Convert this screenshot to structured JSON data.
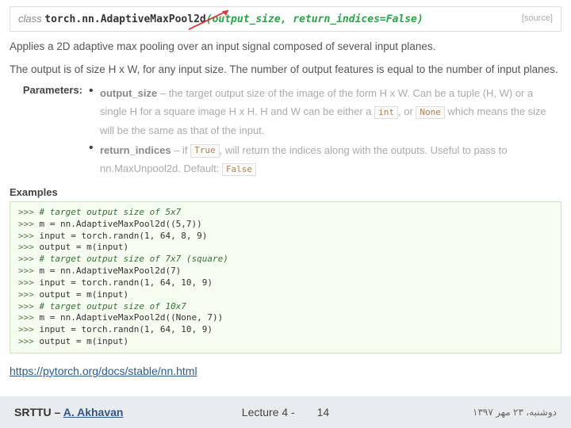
{
  "sig": {
    "kw": "class",
    "name": "torch.nn.AdaptiveMaxPool2d",
    "args": "(output_size, return_indices=False)",
    "source": "[source]"
  },
  "desc1": "Applies a 2D adaptive max pooling over an input signal composed of several input planes.",
  "desc2": "The output is of size H x W, for any input size. The number of output features is equal to the number of input planes.",
  "params_label": "Parameters:",
  "param1": {
    "name": "output_size",
    "t1": " – the target output size of the image of the form H x W. Can be a tuple (H, W) or a single H for a square image H x H. H and W can be either a ",
    "pill1": "int",
    "t2": ", or ",
    "pill2": "None",
    "t3": " which means the size will be the same as that of the input."
  },
  "param2": {
    "name": "return_indices",
    "t1": " – if ",
    "pill1": "True",
    "t2": ", will return the indices along with the outputs. Useful to pass to nn.MaxUnpool2d. Default: ",
    "pill2": "False"
  },
  "examples_label": "Examples",
  "code": {
    "l1": "# target output size of 5x7",
    "l2": "m = nn.AdaptiveMaxPool2d((5,7))",
    "l3": "input = torch.randn(1, 64, 8, 9)",
    "l4": "output = m(input)",
    "l5": "# target output size of 7x7 (square)",
    "l6": "m = nn.AdaptiveMaxPool2d(7)",
    "l7": "input = torch.randn(1, 64, 10, 9)",
    "l8": "output = m(input)",
    "l9": "# target output size of 10x7",
    "l10": "m = nn.AdaptiveMaxPool2d((None, 7))",
    "l11": "input = torch.randn(1, 64, 10, 9)",
    "l12": "output = m(input)",
    "prompt": ">>> "
  },
  "url": "https://pytorch.org/docs/stable/nn.html",
  "footer": {
    "org": "SRTTU – ",
    "author": "A. Akhavan",
    "lecture": "Lecture 4 -",
    "page": "14",
    "date": "دوشنبه، ۲۳ مهر ۱۳۹۷"
  }
}
